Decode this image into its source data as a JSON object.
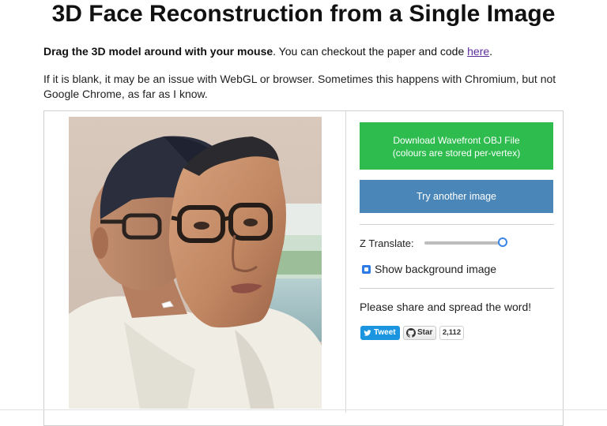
{
  "page": {
    "title": "3D Face Reconstruction from a Single Image",
    "intro_bold": "Drag the 3D model around with your mouse",
    "intro_rest": ". You can checkout the paper and code ",
    "intro_link": "here",
    "intro_end": ".",
    "note": "If it is blank, it may be an issue with WebGL or browser. Sometimes this happens with Chromium, but not Google Chrome, as far as I know."
  },
  "controls": {
    "download_label": "Download Wavefront OBJ File",
    "download_sub": "(colours are stored per-vertex)",
    "try_label": "Try another image",
    "z_translate_label": "Z Translate:",
    "z_translate_value": 0.97,
    "show_bg_label": "Show background image",
    "show_bg_checked": true
  },
  "share": {
    "text": "Please share and spread the word!",
    "tweet_label": "Tweet",
    "star_label": "Star",
    "star_count": "2,112"
  },
  "colors": {
    "download": "#2ebc4f",
    "try": "#4a86b8",
    "slider_accent": "#3a86e8",
    "twitter": "#1b95e0",
    "link": "#5c2d9c"
  }
}
